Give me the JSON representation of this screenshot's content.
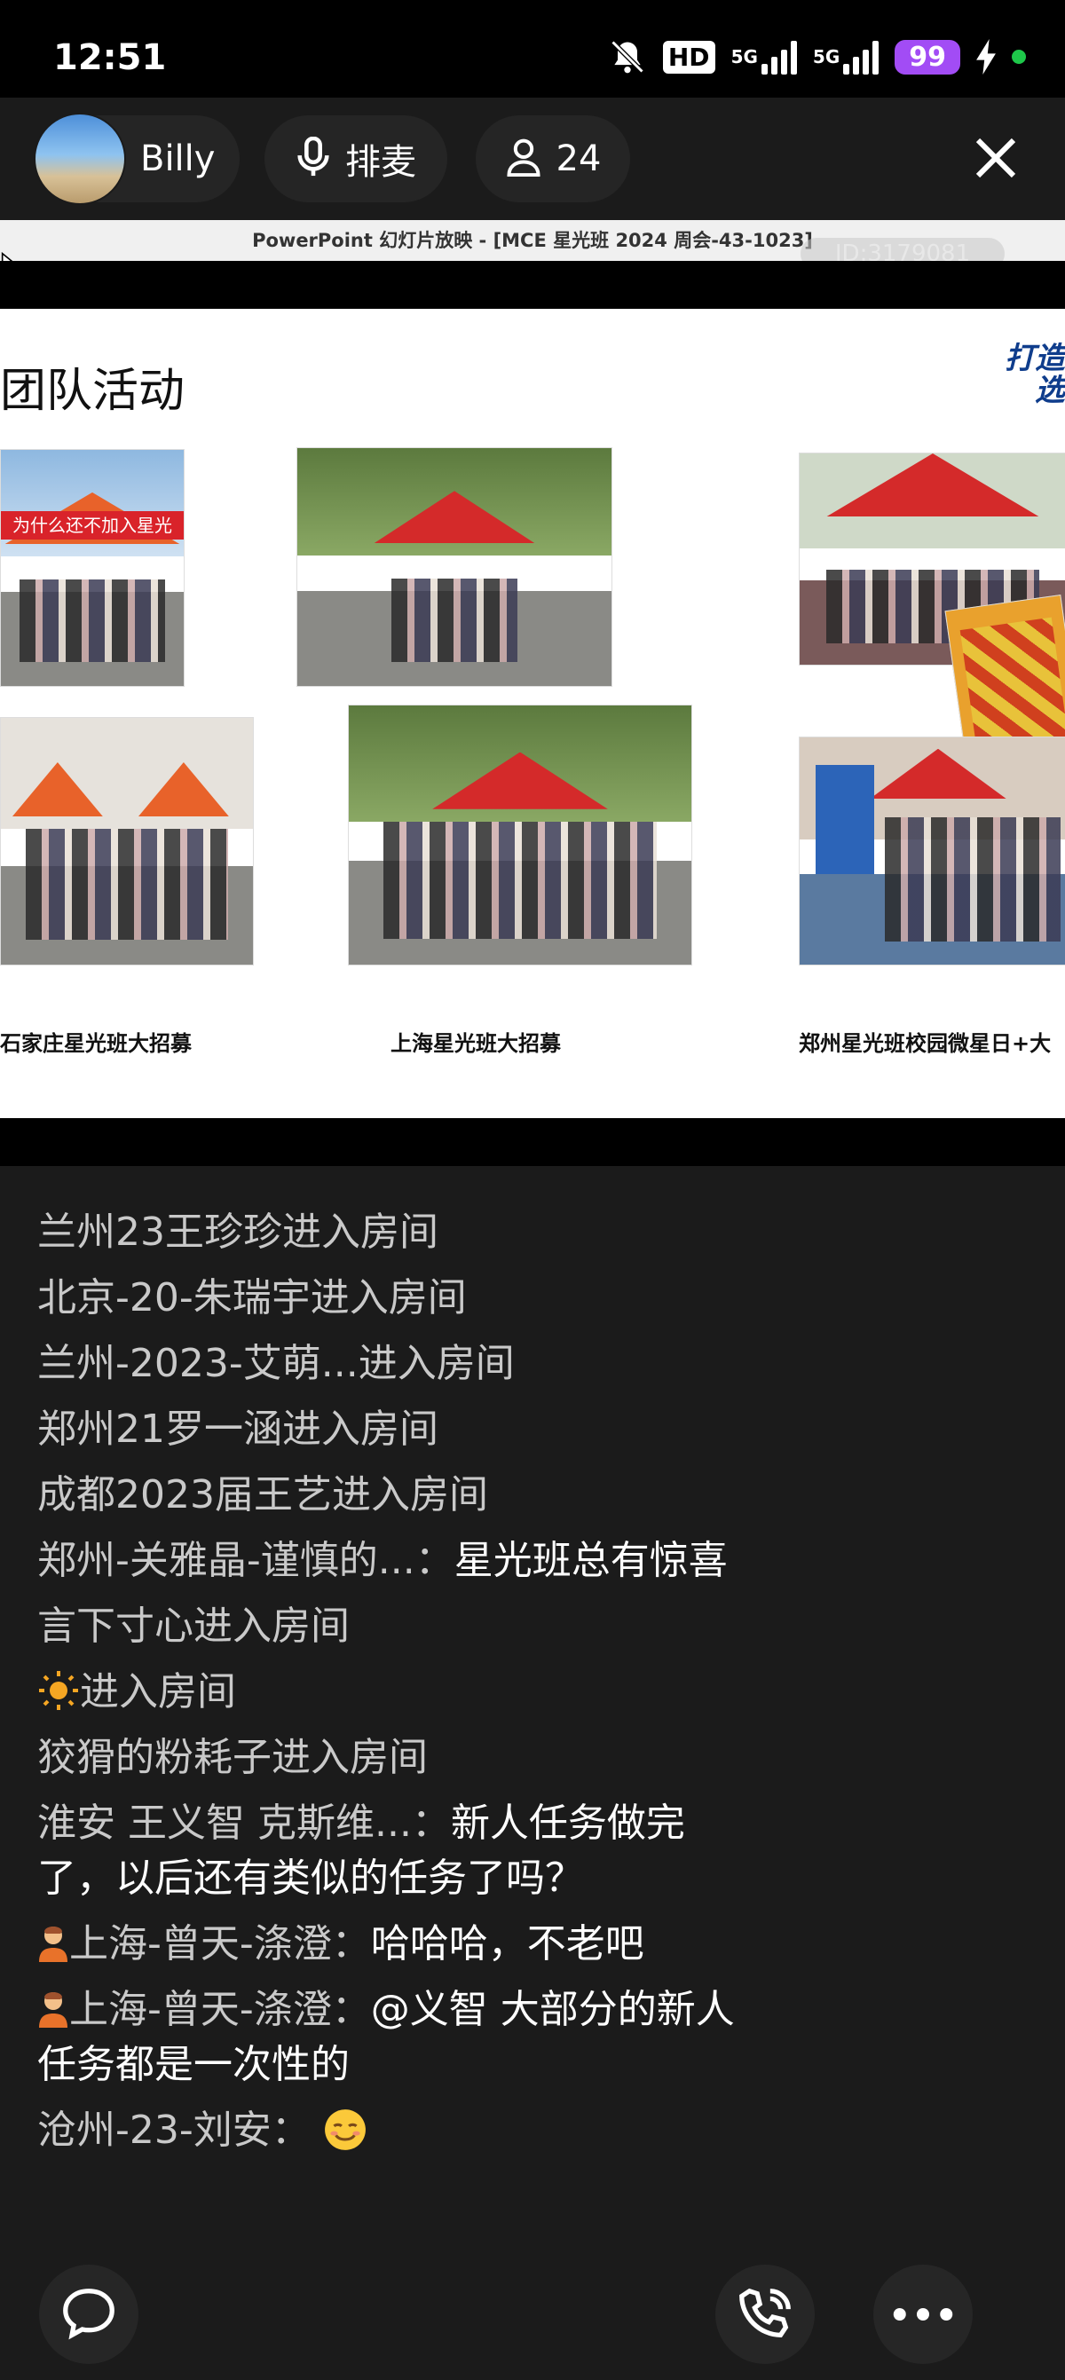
{
  "status_bar": {
    "time": "12:51",
    "hd_label": "HD",
    "network1_label": "5G",
    "network2_label": "5G",
    "battery": "99",
    "icons": [
      "mute-bell-icon",
      "hd-icon",
      "signal-icon",
      "signal-icon",
      "battery-icon",
      "charging-icon",
      "mic-dot-icon"
    ]
  },
  "header": {
    "user_name": "Billy",
    "queue_label": "排麦",
    "viewer_count": "24",
    "icons": [
      "avatar",
      "microphone-icon",
      "person-icon",
      "close-icon"
    ]
  },
  "slide": {
    "window_title": "PowerPoint 幻灯片放映 - [MCE 星光班 2024 周会-43-1023]",
    "room_id": "ID:3179081",
    "heading": "团队活动",
    "logo_text_line1": "打造",
    "logo_text_line2": "选",
    "captions": [
      "石家庄星光班大招募",
      "上海星光班大招募",
      "郑州星光班校园微星日+大"
    ],
    "banner_text": "为什么还不加入星光班!"
  },
  "chat": {
    "messages": [
      {
        "nick": "兰州23王珍珍进入房间",
        "text": ""
      },
      {
        "nick": "北京-20-朱瑞宇进入房间",
        "text": ""
      },
      {
        "nick": "兰州-2023-艾萌...进入房间",
        "text": ""
      },
      {
        "nick": "郑州21罗一涵进入房间",
        "text": ""
      },
      {
        "nick": "成都2023届王艺进入房间",
        "text": ""
      },
      {
        "nick": "郑州-关雅晶-谨慎的...：",
        "text": "星光班总有惊喜"
      },
      {
        "nick": "言下寸心进入房间",
        "text": ""
      },
      {
        "nick": "进入房间",
        "text": ""
      },
      {
        "nick": "狡猾的粉耗子进入房间",
        "text": ""
      },
      {
        "nick": "淮安 王义智 克斯维...：",
        "text": "新人任务做完了，以后还有类似的任务了吗？"
      },
      {
        "nick": "上海-曾天-涤澄：",
        "text": "哈哈哈，不老吧"
      },
      {
        "nick": "上海-曾天-涤澄：",
        "text": "@义智 大部分的新人任务都是一次性的"
      },
      {
        "nick": "沧州-23-刘安：",
        "text": ""
      }
    ]
  },
  "bottom_bar": {
    "icons": [
      "chat-bubble-icon",
      "phone-call-icon",
      "more-icon"
    ]
  },
  "colors": {
    "background": "#1b1b1b",
    "battery": "#a24cf5",
    "tent_red": "#d42a2a",
    "mic_dot": "#1ec84a"
  }
}
